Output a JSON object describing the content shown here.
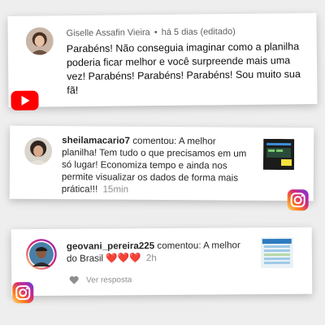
{
  "youtube_comment": {
    "author": "Giselle Assafin Vieira",
    "time": "há 5 dias (editado)",
    "text": "Parabéns! Não conseguia imaginar como a planilha poderia ficar melhor e você surpreende mais uma vez! Parabéns! Parabéns! Parabéns! Sou muito sua fã!",
    "platform_icon": "youtube-logo-icon"
  },
  "instagram_comment_1": {
    "username": "sheilamacario7",
    "text": "comentou: A melhor planilha! Tem tudo o que precisamos em um só lugar! Economiza tempo e ainda nos permite visualizar os dados de forma mais prática!!!",
    "time": "15min",
    "platform_icon": "instagram-logo-icon"
  },
  "instagram_comment_2": {
    "username": "geovani_pereira225",
    "text": "comentou: A melhor do Brasil",
    "hearts": "❤️❤️❤️",
    "time": "2h",
    "reply_label": "Ver resposta",
    "platform_icon": "instagram-logo-icon"
  },
  "colors": {
    "youtube_red": "#ff0000",
    "instagram_gradient": [
      "#feda75",
      "#fa7e1e",
      "#d62976",
      "#962fbf",
      "#4f5bd5"
    ],
    "text_primary": "#262626",
    "text_secondary": "#8e8e8e"
  }
}
